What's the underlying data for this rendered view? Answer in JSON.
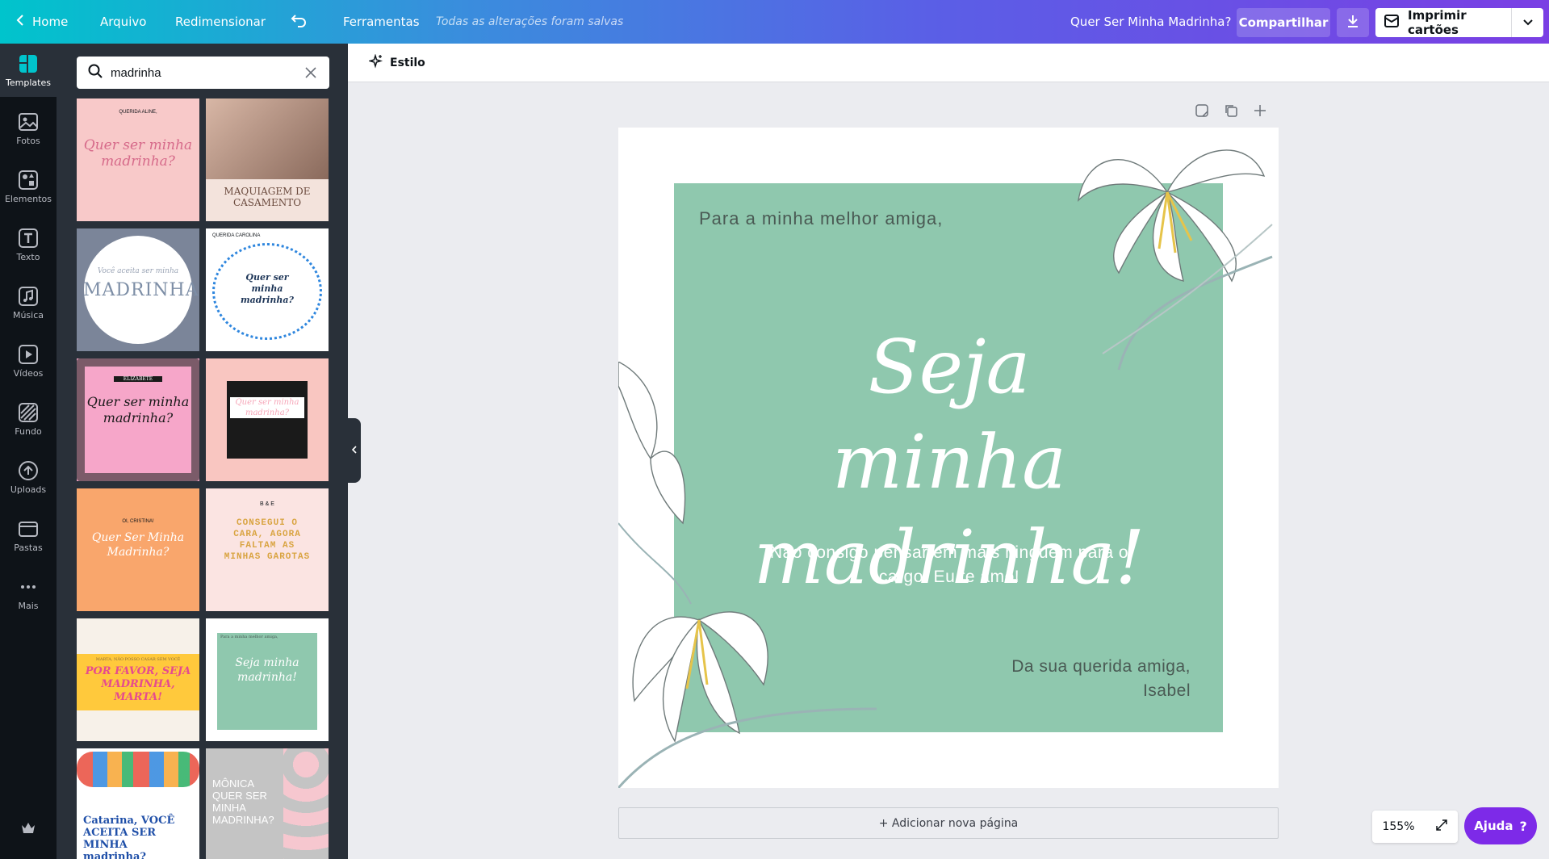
{
  "topbar": {
    "home_label": "Home",
    "file_label": "Arquivo",
    "resize_label": "Redimensionar",
    "tools_label": "Ferramentas",
    "saved_status": "Todas as alterações foram salvas",
    "design_title": "Quer Ser Minha Madrinha?",
    "share_label": "Compartilhar",
    "print_label": "Imprimir cartões"
  },
  "leftnav": {
    "items": [
      {
        "label": "Templates",
        "icon": "templates-icon"
      },
      {
        "label": "Fotos",
        "icon": "photos-icon"
      },
      {
        "label": "Elementos",
        "icon": "elements-icon"
      },
      {
        "label": "Texto",
        "icon": "text-icon"
      },
      {
        "label": "Música",
        "icon": "music-icon"
      },
      {
        "label": "Vídeos",
        "icon": "video-icon"
      },
      {
        "label": "Fundo",
        "icon": "background-icon"
      },
      {
        "label": "Uploads",
        "icon": "upload-icon"
      },
      {
        "label": "Pastas",
        "icon": "folder-icon"
      },
      {
        "label": "Mais",
        "icon": "more-icon"
      }
    ]
  },
  "search": {
    "value": "madrinha"
  },
  "templates": [
    {
      "text": "Quer ser minha madrinha?",
      "bg": "#f8c9c9",
      "color": "#d66a8a",
      "small_top": "QUERIDA ALINE,"
    },
    {
      "text": "MAQUIAGEM DE CASAMENTO",
      "bg": "#f3e3dc",
      "color": "#6b4b3e",
      "small_top": ""
    },
    {
      "text": "MADRINHA?",
      "bg": "#7b8599",
      "color": "#7d8ea6",
      "small_top": "Você aceita ser minha"
    },
    {
      "text": "Quer ser minha madrinha?",
      "bg": "#ffffff",
      "color": "#1d3557",
      "small_top": "QUERIDA CAROLINA"
    },
    {
      "text": "Quer ser minha madrinha?",
      "bg": "#f6a6c9",
      "color": "#1a1a1a",
      "small_top": "ELIZABETE"
    },
    {
      "text": "Quer ser minha madrinha?",
      "bg": "#f9c6c1",
      "color": "#f6a6b8",
      "small_top": ""
    },
    {
      "text": "Quer Ser Minha Madrinha?",
      "bg": "#f9a66c",
      "color": "#ffffff",
      "small_top": "OI, CRISTINA!"
    },
    {
      "text": "CONSEGUI O CARA, AGORA FALTAM AS MINHAS GAROTAS",
      "bg": "#fbe4e2",
      "color": "#d9a441",
      "small_top": "B & E"
    },
    {
      "text": "POR FAVOR, SEJA MADRINHA, MARTA!",
      "bg": "#f7f1e9",
      "color": "#e64b8e",
      "small_top": "MARTA, NÃO POSSO CASAR SEM VOCÊ"
    },
    {
      "text": "Seja minha madrinha!",
      "bg": "#ffffff",
      "color": "#ffffff",
      "small_top": "Para a minha melhor amiga,"
    },
    {
      "text": "Catarina, VOCÊ ACEITA SER MINHA madrinha?",
      "bg": "#ffffff",
      "color": "#1f4fa8",
      "small_top": ""
    },
    {
      "text": "MÔNICA QUER SER MINHA MADRINHA?",
      "bg": "#c4c4c4",
      "color": "#ffffff",
      "small_top": ""
    }
  ],
  "stylebar": {
    "style_label": "Estilo"
  },
  "design": {
    "greeting": "Para a minha melhor amiga,",
    "title": "Seja minha madrinha!",
    "body": "Não consigo pensar em mais ninguém para o cargo. Eu te amo!",
    "sign_line1": "Da sua querida amiga,",
    "sign_line2": "Isabel",
    "panel_color": "#8fc8ae"
  },
  "add_page_label": "+ Adicionar nova página",
  "zoom_label": "155%",
  "help_label": "Ajuda",
  "help_symbol": "?"
}
